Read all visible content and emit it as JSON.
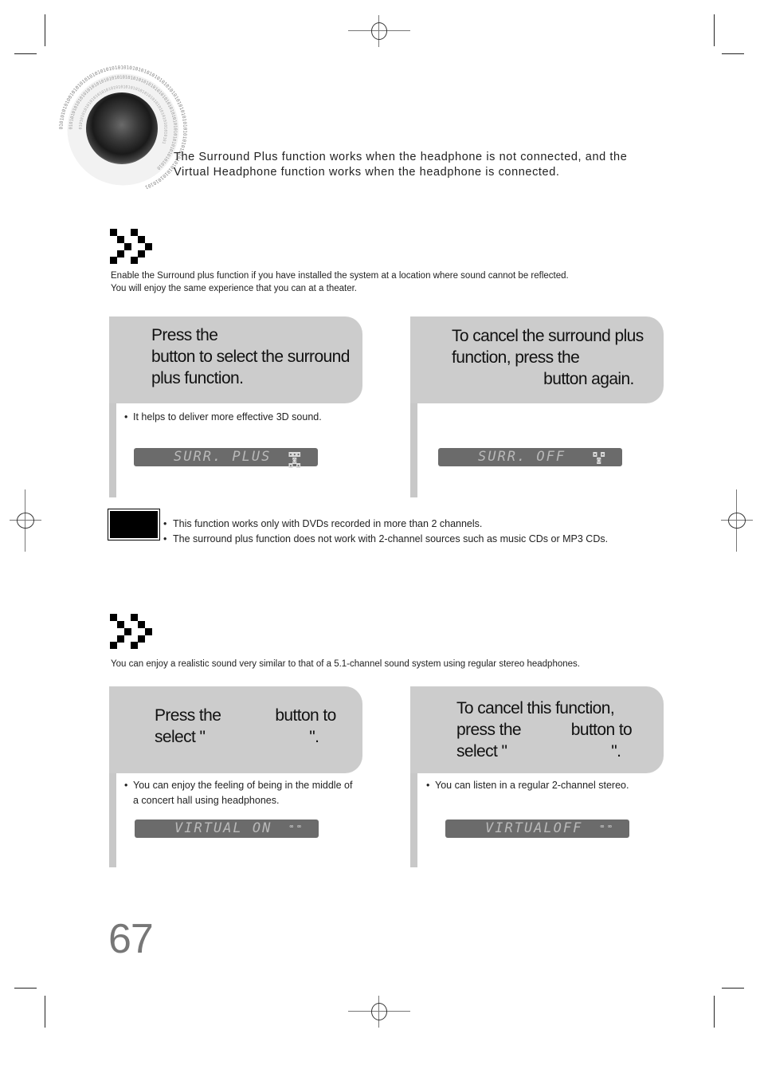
{
  "intro": {
    "line1": "The Surround Plus function works when the headphone is not connected, and the",
    "line2": "Virtual Headphone function works when the headphone is connected."
  },
  "section1": {
    "icon": "double-chevron-right-icon",
    "desc_line1": "Enable the Surround plus function if you have installed the system at a location where sound cannot be reflected.",
    "desc_line2": "You will enjoy the same experience that you can at a theater.",
    "step_left": {
      "heading": "Press the\nbutton to select the surround\nplus function.",
      "bullet": "It helps to deliver more effective 3D sound.",
      "display": "SURR. PLUS",
      "display_icon": "speaker-channels-icon"
    },
    "step_right": {
      "heading": "To cancel the surround plus\nfunction, press the\n                      button again.",
      "display": "SURR. OFF",
      "display_icon": "speaker-channels-icon"
    }
  },
  "note": {
    "label_icon": "note-badge",
    "items": [
      "This function works only with DVDs recorded in more than 2 channels.",
      "The surround plus function does not work with 2-channel sources such as music CDs or MP3 CDs."
    ]
  },
  "section2": {
    "icon": "double-chevron-right-icon",
    "desc_line1": "You can enjoy a realistic sound very similar to that of a 5.1-channel sound system using regular stereo headphones.",
    "step_left": {
      "heading": "Press the             button to\nselect \"                         \".",
      "bullet_line1": "You can enjoy the feeling of being in the middle of",
      "bullet_line2": "a concert hall using headphones.",
      "display": "VIRTUAL  ON",
      "display_icon": "headphone-icon"
    },
    "step_right": {
      "heading": "To cancel this function,\npress the            button to\nselect \"                         \".",
      "bullet": "You can listen in a regular 2-channel stereo.",
      "display": "VIRTUALOFF",
      "display_icon": "headphone-icon"
    }
  },
  "page_number": "67"
}
